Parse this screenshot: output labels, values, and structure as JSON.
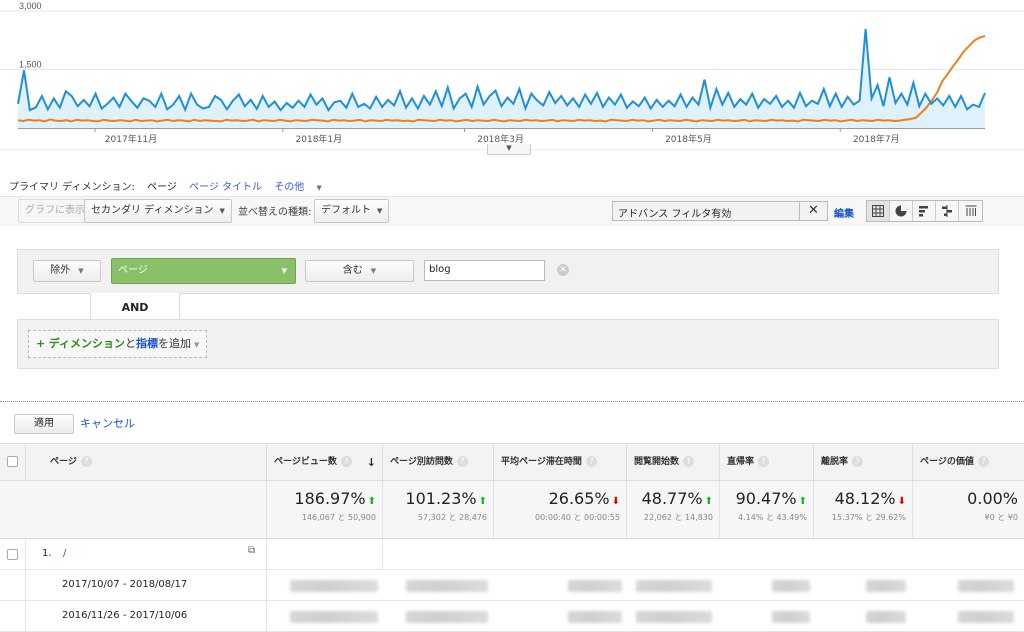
{
  "chart": {
    "y_ticks": [
      "3,000",
      "1,500"
    ],
    "x_ticks": [
      "2017年11月",
      "2018年1月",
      "2018年3月",
      "2018年5月",
      "2018年7月"
    ],
    "colors": {
      "current": "#1f8fd6",
      "previous": "#f07e1e",
      "fill": "#dff1fa"
    }
  },
  "chart_data": {
    "type": "line",
    "ylim": [
      0,
      3000
    ],
    "y_ticks": [
      1500,
      3000
    ],
    "x_range": [
      "2017-10-07",
      "2018-08-17"
    ],
    "series": [
      {
        "values": [
          620,
          1480,
          460,
          530,
          820,
          480,
          760,
          520,
          940,
          820,
          560,
          720,
          560,
          880,
          500,
          620,
          780,
          540,
          880,
          690,
          520,
          760,
          700,
          540,
          880,
          480,
          600,
          820,
          470,
          880,
          600,
          500,
          540,
          820,
          720,
          480,
          700,
          860,
          560,
          720,
          490,
          820,
          540,
          680,
          460,
          640,
          520,
          700,
          540,
          860,
          600,
          760,
          460,
          660,
          700,
          520,
          880,
          540,
          620,
          500,
          800,
          540,
          720,
          580,
          940,
          520,
          760,
          500,
          820,
          600,
          940,
          560,
          1040,
          500,
          760,
          880,
          540,
          1060,
          600,
          820,
          960,
          560,
          780,
          620,
          1000,
          500,
          880,
          700,
          580,
          920,
          640,
          820,
          580,
          760,
          540,
          860,
          620,
          900,
          540,
          780,
          600,
          860,
          520,
          680,
          560,
          780,
          500,
          720,
          540,
          700,
          560,
          860,
          540,
          780,
          600,
          1240,
          520,
          1000,
          600,
          900,
          540,
          740,
          600,
          880,
          520,
          740,
          620,
          820,
          540,
          700,
          520,
          900,
          560,
          700,
          620,
          1000,
          560,
          880,
          540,
          800,
          600,
          700,
          2540,
          760,
          1100,
          560,
          1300,
          640,
          880,
          600,
          1160,
          560,
          880,
          620,
          760,
          580,
          820,
          540,
          820,
          480,
          600,
          540,
          900
        ]
      },
      {
        "values": [
          200,
          180,
          210,
          190,
          200,
          170,
          220,
          190,
          180,
          200,
          170,
          210,
          190,
          200,
          180,
          170,
          210,
          190,
          180,
          200,
          190,
          170,
          210,
          180,
          190,
          200,
          170,
          190,
          210,
          180,
          200,
          190,
          170,
          210,
          180,
          200,
          190,
          180,
          170,
          210,
          190,
          200,
          180,
          190,
          210,
          170,
          200,
          190,
          180,
          210,
          190,
          170,
          200,
          190,
          180,
          210,
          200,
          190,
          170,
          210,
          190,
          200,
          180,
          190,
          210,
          170,
          200,
          190,
          180,
          210,
          190,
          200,
          180,
          190,
          170,
          210,
          200,
          190,
          180,
          210,
          190,
          200,
          170,
          190,
          210,
          180,
          200,
          190,
          180,
          210,
          190,
          170,
          200,
          190,
          180,
          210,
          190,
          200,
          180,
          190,
          210,
          170,
          200,
          190,
          180,
          210,
          190,
          200,
          180,
          190,
          170,
          210,
          200,
          190,
          180,
          210,
          190,
          200,
          170,
          190,
          210,
          180,
          200,
          190,
          180,
          210,
          190,
          170,
          200,
          190,
          180,
          210,
          190,
          200,
          180,
          190,
          210,
          170,
          200,
          190,
          180,
          210,
          190,
          200,
          180,
          190,
          170,
          210,
          200,
          190,
          180,
          210,
          190,
          200,
          170,
          190,
          210,
          180,
          200,
          190,
          180,
          210,
          190,
          200,
          180,
          190,
          210,
          230,
          260,
          380,
          520,
          700,
          900,
          1200,
          1380,
          1580,
          1760,
          1960,
          2100,
          2240,
          2320,
          2360
        ]
      }
    ]
  },
  "primary_dimension": {
    "label": "プライマリ ディメンション:",
    "options": [
      "ページ",
      "ページ タイトル",
      "その他"
    ]
  },
  "toolbar": {
    "graph_btn": "グラフに表示",
    "secondary_dim": "セカンダリ ディメンション",
    "sort_type_label": "並べ替えの種類:",
    "sort_type": "デフォルト",
    "filter_text": "アドバンス フィルタ有効",
    "edit": "編集"
  },
  "advanced_filter": {
    "mode": "除外",
    "dimension": "ページ",
    "operator": "含む",
    "value": "blog",
    "and_label": "AND",
    "add_prefix": "+",
    "add_dimension": "ディメンション",
    "add_and": "と",
    "add_metric": "指標",
    "add_suffix": "を追加"
  },
  "actions": {
    "apply": "適用",
    "cancel": "キャンセル"
  },
  "table": {
    "headers": [
      "ページ",
      "ページビュー数",
      "ページ別訪問数",
      "平均ページ滞在時間",
      "閲覧開始数",
      "直帰率",
      "離脱率",
      "ページの価値"
    ],
    "totals": [
      {
        "pct": "186.97%",
        "trend": "up",
        "sub": "146,067 と 50,900"
      },
      {
        "pct": "101.23%",
        "trend": "up",
        "sub": "57,302 と 28,476"
      },
      {
        "pct": "26.65%",
        "trend": "down",
        "sub": "00:00:40 と 00:00:55"
      },
      {
        "pct": "48.77%",
        "trend": "up",
        "sub": "22,062 と 14,830"
      },
      {
        "pct": "90.47%",
        "trend": "up",
        "sub": "4.14% と 43.49%"
      },
      {
        "pct": "48.12%",
        "trend": "down",
        "sub": "15.37% と 29.62%"
      },
      {
        "pct": "0.00%",
        "trend": "none",
        "sub": "¥0 と ¥0"
      }
    ],
    "row1": {
      "num": "1.",
      "page": "/"
    },
    "date_rows": [
      "2017/10/07 - 2018/08/17",
      "2016/11/26 - 2017/10/06"
    ]
  }
}
